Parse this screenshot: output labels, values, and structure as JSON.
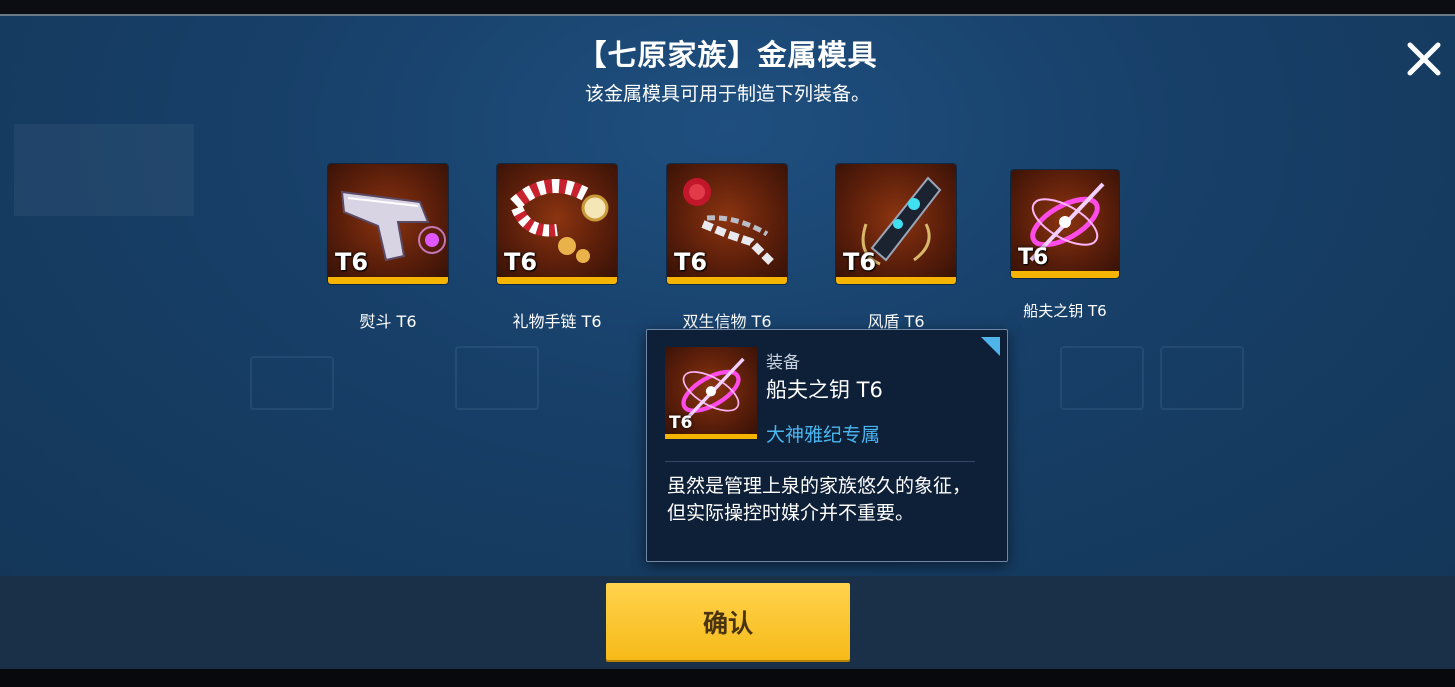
{
  "dialog": {
    "title": "【七原家族】金属模具",
    "subtitle": "该金属模具可用于制造下列装备。"
  },
  "items": [
    {
      "tier": "T6",
      "name": "熨斗  T6",
      "icon": "pistol-icon"
    },
    {
      "tier": "T6",
      "name": "礼物手链  T6",
      "icon": "gift-bracelet-icon"
    },
    {
      "tier": "T6",
      "name": "双生信物  T6",
      "icon": "rose-chain-icon"
    },
    {
      "tier": "T6",
      "name": "风盾  T6",
      "icon": "wind-shield-icon"
    },
    {
      "tier": "T6",
      "name": "船夫之钥  T6",
      "icon": "ferryman-key-icon"
    }
  ],
  "tooltip": {
    "category": "装备",
    "name": "船夫之钥  T6",
    "tier": "T6",
    "exclusive": "大神雅纪专属",
    "description": "虽然是管理上泉的家族悠久的象征，但实际操控时媒介并不重要。"
  },
  "buttons": {
    "confirm_label": "确认"
  },
  "colors": {
    "accent_yellow": "#f4b400",
    "exclusive_blue": "#49b6f0",
    "panel_blue": "#173f68"
  }
}
